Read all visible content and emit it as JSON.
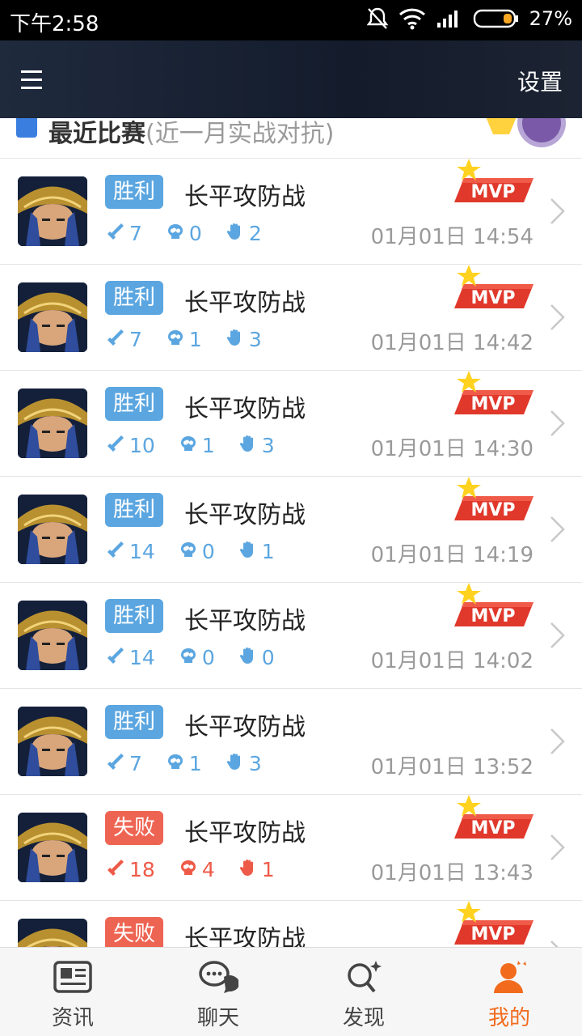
{
  "status_bar": {
    "time": "下午2:58",
    "battery": "27%"
  },
  "header": {
    "settings_label": "设置"
  },
  "section": {
    "title": "最近比赛",
    "subtitle": "(近一月实战对抗)"
  },
  "mvp_label": "MVP",
  "matches": [
    {
      "result": "胜利",
      "type": "win",
      "mode": "长平攻防战",
      "kills": "7",
      "deaths": "0",
      "assists": "2",
      "time": "01月01日 14:54",
      "mvp": true
    },
    {
      "result": "胜利",
      "type": "win",
      "mode": "长平攻防战",
      "kills": "7",
      "deaths": "1",
      "assists": "3",
      "time": "01月01日 14:42",
      "mvp": true
    },
    {
      "result": "胜利",
      "type": "win",
      "mode": "长平攻防战",
      "kills": "10",
      "deaths": "1",
      "assists": "3",
      "time": "01月01日 14:30",
      "mvp": true
    },
    {
      "result": "胜利",
      "type": "win",
      "mode": "长平攻防战",
      "kills": "14",
      "deaths": "0",
      "assists": "1",
      "time": "01月01日 14:19",
      "mvp": true
    },
    {
      "result": "胜利",
      "type": "win",
      "mode": "长平攻防战",
      "kills": "14",
      "deaths": "0",
      "assists": "0",
      "time": "01月01日 14:02",
      "mvp": true
    },
    {
      "result": "胜利",
      "type": "win",
      "mode": "长平攻防战",
      "kills": "7",
      "deaths": "1",
      "assists": "3",
      "time": "01月01日 13:52",
      "mvp": false
    },
    {
      "result": "失败",
      "type": "lose",
      "mode": "长平攻防战",
      "kills": "18",
      "deaths": "4",
      "assists": "1",
      "time": "01月01日 13:43",
      "mvp": true
    },
    {
      "result": "失败",
      "type": "lose",
      "mode": "长平攻防战",
      "kills": "",
      "deaths": "",
      "assists": "",
      "time": "",
      "mvp": true
    }
  ],
  "bottom_nav": [
    {
      "label": "资讯",
      "icon": "news-icon"
    },
    {
      "label": "聊天",
      "icon": "chat-icon"
    },
    {
      "label": "发现",
      "icon": "discover-icon"
    },
    {
      "label": "我的",
      "icon": "profile-icon",
      "active": true
    }
  ],
  "colors": {
    "win": "#5ba6e0",
    "lose": "#ee6452",
    "accent": "#f26b1d"
  }
}
